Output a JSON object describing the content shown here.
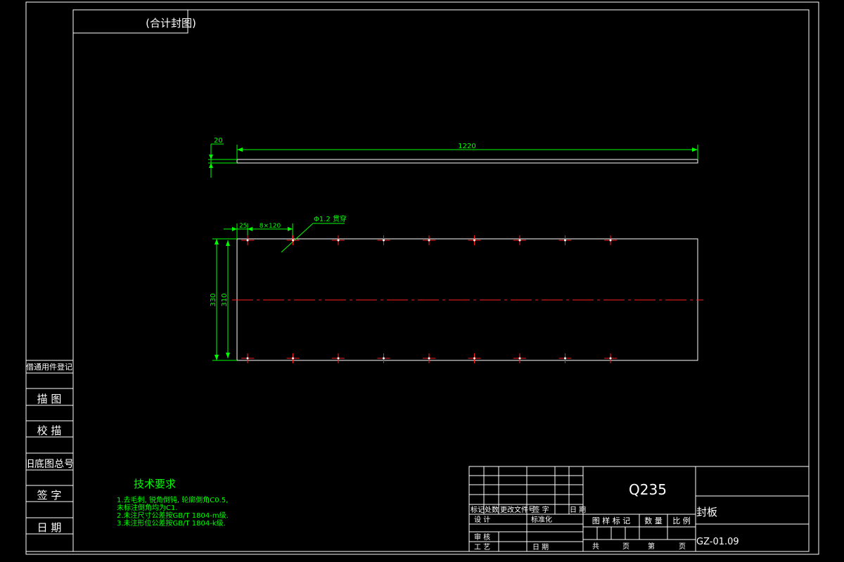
{
  "top_label": "(合计封图)",
  "colors": {
    "background": "#000000",
    "frame": "#ffffff",
    "dimension": "#00ff00",
    "centerline": "#ff2020",
    "note_heading": "#00ff00"
  },
  "side_view": {
    "thickness_label": "20",
    "length_label": "1220"
  },
  "front_view": {
    "offset_label": "25",
    "pitch_label": "8×120",
    "hole_label": "Φ1.2 贯穿",
    "height_outer_label": "330",
    "height_inner_label": "310",
    "holes_per_row": 9
  },
  "left_column": [
    "借通用件登记",
    "描 图",
    "校 描",
    "旧底图总号",
    "签 字",
    "日 期"
  ],
  "tech_requirements": {
    "heading": "技术要求",
    "items": [
      "1.去毛刺, 锐角倒钝, 轮廓倒角C0.5,",
      "未标注倒角均为C1.",
      "2.未注尺寸公差按GB/T 1804-m级.",
      "3.未注形位公差按GB/T 1804-k级."
    ]
  },
  "title_block": {
    "material": "Q235",
    "part_name": "封板",
    "drawing_number": "GZ-01.09",
    "revision_headers": [
      "标记",
      "处数",
      "更改文件号",
      "签 字",
      "日 期"
    ],
    "role_design": "设 计",
    "role_standard": "标准化",
    "role_review": "审 核",
    "role_process": "工 艺",
    "role_date": "日 期",
    "mark_header": "图 样 标 记",
    "qty_header": "数 量",
    "scale_header": "比 例",
    "total_label": "共",
    "page_label": "页",
    "sheet_label": "第",
    "sheet_page_label": "页"
  }
}
